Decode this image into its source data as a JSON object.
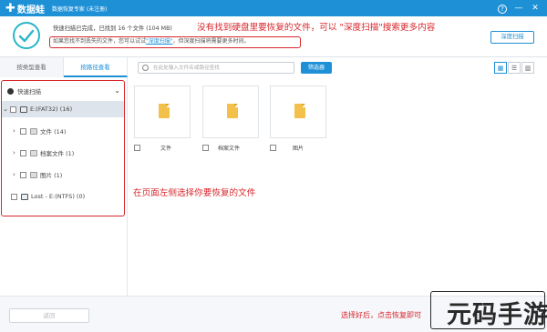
{
  "titlebar": {
    "logo_text": "数据蛙",
    "title": "数据恢复专家 (未注册)",
    "help": "?",
    "minimize": "—",
    "close": "✕"
  },
  "status": {
    "line1": "快速扫描已完成，已找到 16 个文件 (104 MB)",
    "line2_prefix": "如果您找不到丢失的文件，您可以试试",
    "line2_link": "\"深度扫描\"",
    "line2_suffix": "，但深度扫描将需要更多时间。",
    "deep_scan_button": "深度扫描"
  },
  "annotations": {
    "top": "没有找到硬盘里要恢复的文件，可以 \"深度扫描\"搜索更多内容",
    "middle": "在页面左侧选择你要恢复的文件",
    "bottom": "选择好后，点击恢复即可"
  },
  "tabs": [
    {
      "label": "按类型查看"
    },
    {
      "label": "按路径查看"
    }
  ],
  "tree": {
    "header": "快速扫描",
    "items": [
      {
        "label": "E:(FAT32) (16)"
      },
      {
        "label": "文件 (14)"
      },
      {
        "label": "档案文件 (1)"
      },
      {
        "label": "图片 (1)"
      },
      {
        "label": "Lost - E:(NTFS) (0)"
      }
    ]
  },
  "toolbar": {
    "search_placeholder": "在此处输入文件名或路径查找",
    "filter_button": "筛选器"
  },
  "files": [
    {
      "name": "文件"
    },
    {
      "name": "档案文件"
    },
    {
      "name": "图片"
    }
  ],
  "bottom": {
    "back_button": "返回"
  },
  "watermark": "元码手游网",
  "colors": {
    "brand": "#1e90d6",
    "annotation": "#d7262c",
    "success": "#29b6c5"
  }
}
